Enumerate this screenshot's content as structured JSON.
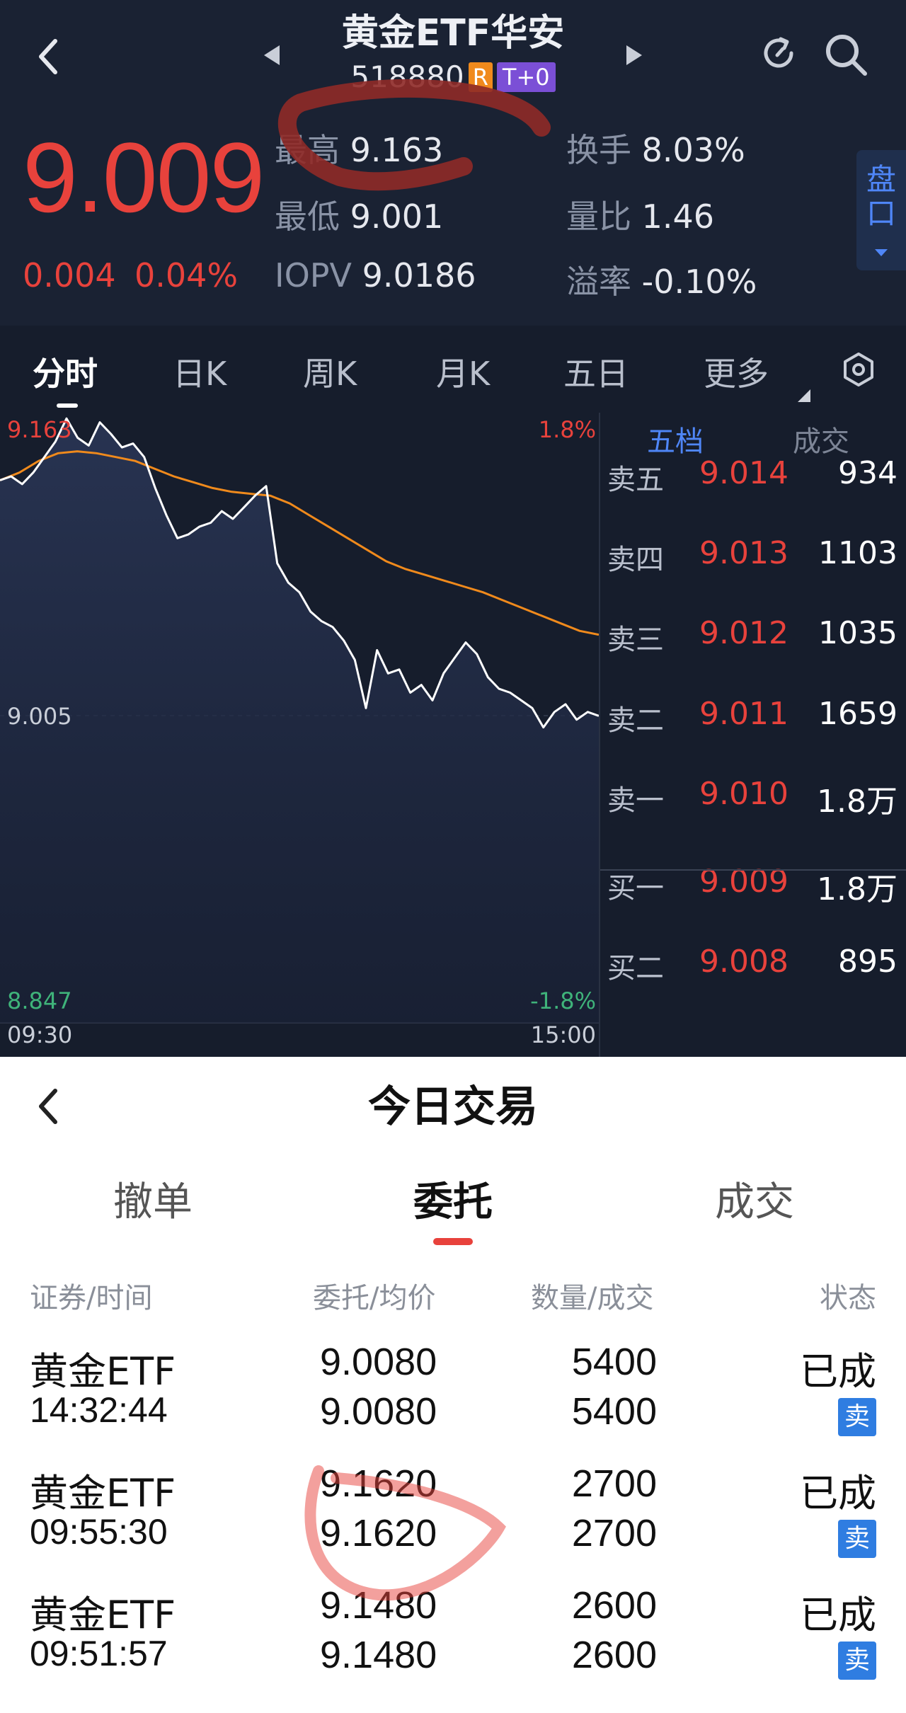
{
  "header": {
    "title": "黄金ETF华安",
    "code": "518880",
    "badge_r": "R",
    "badge_t": "T+0",
    "price": "9.009",
    "change": "0.004",
    "change_pct": "0.04%",
    "stats": {
      "high_label": "最高",
      "high": "9.163",
      "low_label": "最低",
      "low": "9.001",
      "iopv_label": "IOPV",
      "iopv": "9.0186",
      "turnover_label": "换手",
      "turnover": "8.03%",
      "vol_ratio_label": "量比",
      "vol_ratio": "1.46",
      "premium_label": "溢率",
      "premium": "-0.10%"
    },
    "pankou": "盘口",
    "up_color": "#e8423c"
  },
  "tabs": [
    "分时",
    "日K",
    "周K",
    "月K",
    "五日",
    "更多"
  ],
  "chart": {
    "top_price": "9.163",
    "mid_price": "9.005",
    "bottom_price": "8.847",
    "top_pct": "1.8%",
    "bottom_pct": "-1.8%",
    "start_time": "09:30",
    "end_time": "15:00"
  },
  "chart_data": {
    "type": "line",
    "ylim": [
      8.847,
      9.163
    ],
    "x_start": "09:30",
    "x_end": "15:00",
    "series": [
      {
        "values": [
          9.128,
          9.13,
          9.126,
          9.132,
          9.14,
          9.148,
          9.16,
          9.15,
          9.146,
          9.158,
          9.152,
          9.145,
          9.147,
          9.14,
          9.124,
          9.11,
          9.098,
          9.1,
          9.104,
          9.106,
          9.112,
          9.108,
          9.114,
          9.12,
          9.125,
          9.085,
          9.075,
          9.07,
          9.06,
          9.055,
          9.052,
          9.045,
          9.035,
          9.01,
          9.04,
          9.028,
          9.03,
          9.018,
          9.022,
          9.014,
          9.028,
          9.036,
          9.044,
          9.038,
          9.026,
          9.02,
          9.018,
          9.014,
          9.01,
          9.0,
          9.008,
          9.012,
          9.004,
          9.008,
          9.006
        ],
        "color": "#ffffff"
      },
      {
        "values": [
          9.128,
          9.132,
          9.138,
          9.142,
          9.143,
          9.142,
          9.14,
          9.138,
          9.134,
          9.13,
          9.127,
          9.124,
          9.122,
          9.121,
          9.12,
          9.116,
          9.11,
          9.104,
          9.098,
          9.092,
          9.086,
          9.082,
          9.079,
          9.076,
          9.073,
          9.07,
          9.066,
          9.062,
          9.058,
          9.054,
          9.05,
          9.048
        ],
        "color": "#f08a1c"
      }
    ]
  },
  "book": {
    "tab_five": "五档",
    "tab_trades": "成交",
    "rows": [
      {
        "label": "卖五",
        "price": "9.014",
        "vol": "934"
      },
      {
        "label": "卖四",
        "price": "9.013",
        "vol": "1103"
      },
      {
        "label": "卖三",
        "price": "9.012",
        "vol": "1035"
      },
      {
        "label": "卖二",
        "price": "9.011",
        "vol": "1659"
      },
      {
        "label": "卖一",
        "price": "9.010",
        "vol": "1.8万"
      },
      {
        "label": "买一",
        "price": "9.009",
        "vol": "1.8万"
      },
      {
        "label": "买二",
        "price": "9.008",
        "vol": "895"
      }
    ]
  },
  "sheet": {
    "title": "今日交易",
    "tabs": [
      "撤单",
      "委托",
      "成交"
    ],
    "columns": [
      "证券/时间",
      "委托/均价",
      "数量/成交",
      "状态"
    ],
    "orders": [
      {
        "name": "黄金ETF",
        "time": "14:32:44",
        "order_price": "9.0080",
        "avg_price": "9.0080",
        "qty": "5400",
        "filled": "5400",
        "status": "已成",
        "side": "卖"
      },
      {
        "name": "黄金ETF",
        "time": "09:55:30",
        "order_price": "9.1620",
        "avg_price": "9.1620",
        "qty": "2700",
        "filled": "2700",
        "status": "已成",
        "side": "卖"
      },
      {
        "name": "黄金ETF",
        "time": "09:51:57",
        "order_price": "9.1480",
        "avg_price": "9.1480",
        "qty": "2600",
        "filled": "2600",
        "status": "已成",
        "side": "卖"
      }
    ]
  }
}
